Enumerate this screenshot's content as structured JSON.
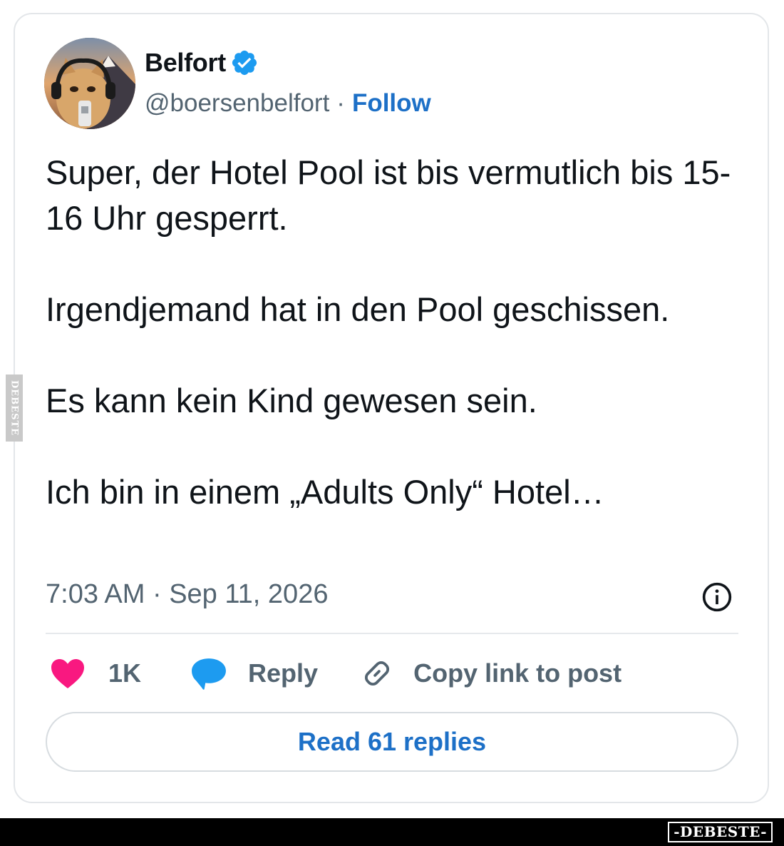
{
  "author": {
    "display_name": "Belfort",
    "verified_icon": "verified-badge-icon",
    "handle": "@boersenbelfort",
    "separator": "·",
    "follow_label": "Follow",
    "avatar": "cat-with-headphones-and-mic"
  },
  "post": {
    "paragraphs": [
      "Super, der Hotel Pool ist bis vermutlich bis 15-16 Uhr gesperrt.",
      "Irgendjemand hat in den Pool geschissen.",
      "Es kann kein Kind gewesen sein.",
      "Ich bin in einem „Adults Only“ Hotel…"
    ],
    "timestamp": "7:03 AM · Sep 11, 2026",
    "info_icon": "info-icon"
  },
  "actions": {
    "like_count": "1K",
    "like_icon": "heart-icon",
    "reply_label": "Reply",
    "reply_icon": "speech-bubble-icon",
    "copy_label": "Copy link to post",
    "copy_icon": "link-icon"
  },
  "read_replies_label": "Read 61 replies",
  "watermark": {
    "side_text": "DEBESTE",
    "footer_text": "-DEBESTE-"
  },
  "colors": {
    "accent_blue": "#1d70c7",
    "heart_pink": "#f91880",
    "reply_blue": "#1d9bf0",
    "muted_text": "#536471",
    "primary_text": "#0f1419"
  }
}
